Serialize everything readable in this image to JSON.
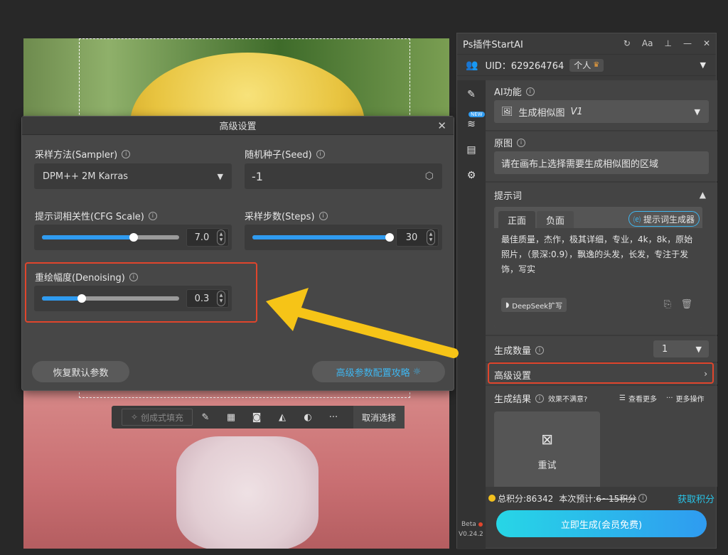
{
  "dialog": {
    "title": "高级设置",
    "sampler_label": "采样方法(Sampler)",
    "sampler_value": "DPM++ 2M Karras",
    "seed_label": "随机种子(Seed)",
    "seed_value": "-1",
    "cfg_label": "提示词相关性(CFG Scale)",
    "cfg_value": "7.0",
    "cfg_fraction": 0.67,
    "steps_label": "采样步数(Steps)",
    "steps_value": "30",
    "steps_fraction": 1.0,
    "denoise_label": "重绘幅度(Denoising)",
    "denoise_value": "0.3",
    "denoise_fraction": 0.29,
    "reset_button": "恢复默认参数",
    "guide_button": "高级参数配置攻略"
  },
  "toolbar": {
    "fill_label": "创成式填充",
    "deselect_label": "取消选择"
  },
  "panel": {
    "title": "Ps插件StartAI",
    "uid": "UID：629264764",
    "account_tag": "个人",
    "ai_function_label": "AI功能",
    "ai_function_value": "生成相似图",
    "ai_function_version": "V1",
    "new_badge": "NEW",
    "source_label": "原图",
    "source_hint": "请在画布上选择需要生成相似图的区域",
    "prompt_label": "提示词",
    "tab_positive": "正面",
    "tab_negative": "负面",
    "prompt_generator": "提示词生成器",
    "prompt_text": "最佳质量，杰作，极其详细，专业，4k，8k，原始照片，（景深:0.9），飘逸的头发，长发，专注于发饰，写实",
    "deepseek_button": "DeepSeek扩写",
    "count_label": "生成数量",
    "count_value": "1",
    "advanced_label": "高级设置",
    "result_label": "生成结果",
    "result_unsatisfied": "效果不满意?",
    "view_more": "查看更多",
    "more_ops": "更多操作",
    "retry_label": "重试",
    "points_total": "总积分:86342",
    "points_estimate_prefix": "本次预计:",
    "points_estimate_value": "6~15积分",
    "get_points": "获取积分",
    "generate_button": "立即生成(会员免费)",
    "beta_label": "Beta",
    "version": "V0.24.2"
  },
  "colors": {
    "accent_blue": "#2f9bf0",
    "highlight_red": "#e0452c",
    "arrow_yellow": "#f6c417",
    "points_gold": "#f2c01e",
    "get_points_cyan": "#28c4e8"
  }
}
